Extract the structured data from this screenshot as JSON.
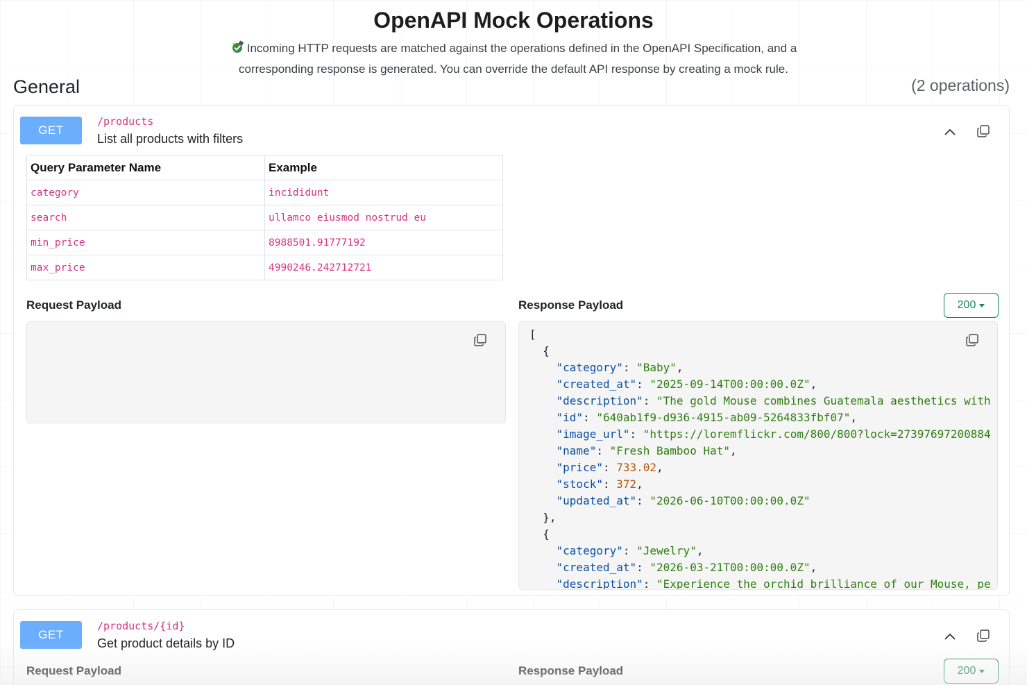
{
  "page": {
    "title": "OpenAPI Mock Operations",
    "subtitle_line1": "Incoming HTTP requests are matched against the operations defined in the OpenAPI Specification, and a",
    "subtitle_line2": "corresponding response is generated. You can override the default API response by creating a mock rule.",
    "subtitle_icon": "plug-check-icon"
  },
  "section": {
    "title": "General",
    "count": "(2 operations)"
  },
  "operations": [
    {
      "method": "GET",
      "path": "/products",
      "summary": "List all products with filters",
      "params_header": {
        "name": "Query Parameter Name",
        "example": "Example"
      },
      "params": [
        {
          "name": "category",
          "example": "incididunt"
        },
        {
          "name": "search",
          "example": "ullamco eiusmod nostrud eu"
        },
        {
          "name": "min_price",
          "example": "8988501.91777192"
        },
        {
          "name": "max_price",
          "example": "4990246.242712721"
        }
      ],
      "request_label": "Request Payload",
      "response_label": "Response Payload",
      "status": "200",
      "response_lines": [
        "[",
        "  {",
        "    \"category\": \"Baby\",",
        "    \"created_at\": \"2025-09-14T00:00:00.0Z\",",
        "    \"description\": \"The gold Mouse combines Guatemala aesthetics with",
        "    \"id\": \"640ab1f9-d936-4915-ab09-5264833fbf07\",",
        "    \"image_url\": \"https://loremflickr.com/800/800?lock=27397697200884",
        "    \"name\": \"Fresh Bamboo Hat\",",
        "    \"price\": 733.02,",
        "    \"stock\": 372,",
        "    \"updated_at\": \"2026-06-10T00:00:00.0Z\"",
        "  },",
        "  {",
        "    \"category\": \"Jewelry\",",
        "    \"created_at\": \"2026-03-21T00:00:00.0Z\",",
        "    \"description\": \"Experience the orchid brilliance of our Mouse, pe"
      ]
    },
    {
      "method": "GET",
      "path": "/products/{id}",
      "summary": "Get product details by ID",
      "request_label": "Request Payload",
      "response_label": "Response Payload",
      "status": "200"
    }
  ],
  "colors": {
    "method_get": "#6aaefc",
    "path": "#d63384",
    "status_ok": "#198754",
    "json_key": "#0a4fa0",
    "json_string": "#2f7d10",
    "json_number": "#b5550b"
  },
  "icons": {
    "collapse": "chevron-up-icon",
    "copy": "copy-icon"
  }
}
